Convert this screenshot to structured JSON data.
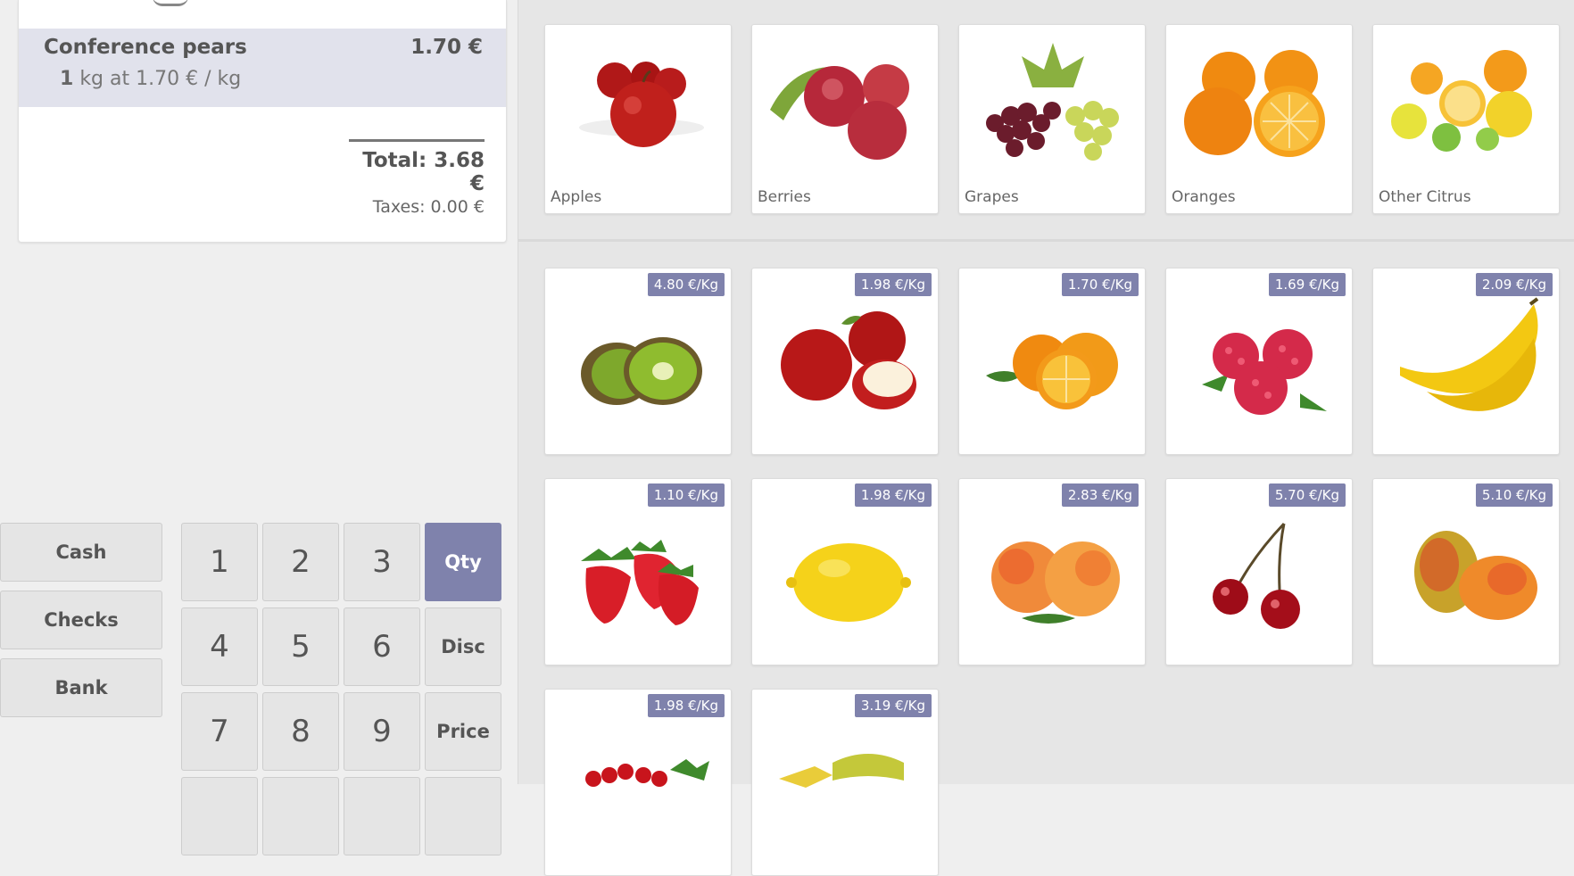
{
  "order": {
    "line": {
      "product": "Conference pears",
      "price": "1.70 €",
      "qty": "1",
      "unit_info": "kg at 1.70 € / kg"
    },
    "total": "Total: 3.68 €",
    "taxes": "Taxes: 0.00 €"
  },
  "payment_methods": [
    "Cash",
    "Checks",
    "Bank"
  ],
  "numpad": {
    "keys": [
      "1",
      "2",
      "3",
      "4",
      "5",
      "6",
      "7",
      "8",
      "9"
    ],
    "modes": [
      "Qty",
      "Disc",
      "Price"
    ],
    "active_mode": "Qty"
  },
  "categories": [
    {
      "name": "Apples",
      "icon": "apples-image"
    },
    {
      "name": "Berries",
      "icon": "berries-image"
    },
    {
      "name": "Grapes",
      "icon": "grapes-image"
    },
    {
      "name": "Oranges",
      "icon": "oranges-image"
    },
    {
      "name": "Other Citrus",
      "icon": "citrus-image"
    }
  ],
  "products": [
    {
      "price": "4.80 €/Kg",
      "icon": "kiwi-image"
    },
    {
      "price": "1.98 €/Kg",
      "icon": "red-apple-image"
    },
    {
      "price": "1.70 €/Kg",
      "icon": "orange-image"
    },
    {
      "price": "1.69 €/Kg",
      "icon": "raspberry-image"
    },
    {
      "price": "2.09 €/Kg",
      "icon": "banana-image"
    },
    {
      "price": "1.10 €/Kg",
      "icon": "strawberry-image"
    },
    {
      "price": "1.98 €/Kg",
      "icon": "lemon-image"
    },
    {
      "price": "2.83 €/Kg",
      "icon": "peach-image"
    },
    {
      "price": "5.70 €/Kg",
      "icon": "cherry-image"
    },
    {
      "price": "5.10 €/Kg",
      "icon": "mango-image"
    },
    {
      "price": "1.98 €/Kg",
      "icon": "redcurrant-image"
    },
    {
      "price": "3.19 €/Kg",
      "icon": "starfruit-image"
    }
  ],
  "colors": {
    "accent": "#7f82ac",
    "selected_line": "#e1e2ec",
    "background": "#efefef"
  }
}
